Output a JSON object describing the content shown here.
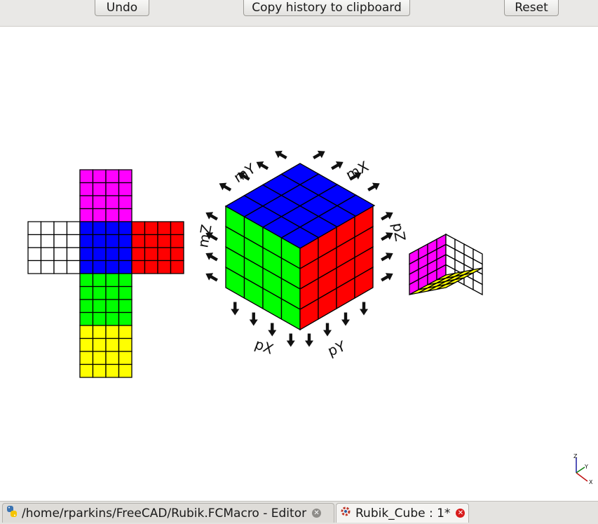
{
  "toolbar": {
    "undo_label": "Undo",
    "copy_label": "Copy history to clipboard",
    "reset_label": "Reset"
  },
  "cube": {
    "size": 4,
    "colors": {
      "top": "#ff00ff",
      "left": "#ffffff",
      "front": "#0000ff",
      "right": "#ff0000",
      "down": "#00ff00",
      "bottom": "#ffff00"
    },
    "main_view": {
      "top": "#0000ff",
      "left": "#00ff00",
      "right": "#ff0000"
    },
    "mini_view": {
      "back_left": "#ff00ff",
      "back_right": "#ffffff",
      "floor": "#ffff00"
    },
    "labels": {
      "my": "mY",
      "mx": "mX",
      "mz": "mZ",
      "pz": "pZ",
      "px": "pX",
      "py": "pY"
    }
  },
  "axis_triad": {
    "x": "X",
    "y": "Y",
    "z": "Z"
  },
  "tabs": [
    {
      "label": "/home/rparkins/FreeCAD/Rubik.FCMacro - Editor",
      "icon": "python-icon",
      "active": false
    },
    {
      "label": "Rubik_Cube : 1*",
      "icon": "freecad-document-icon",
      "active": true
    }
  ]
}
